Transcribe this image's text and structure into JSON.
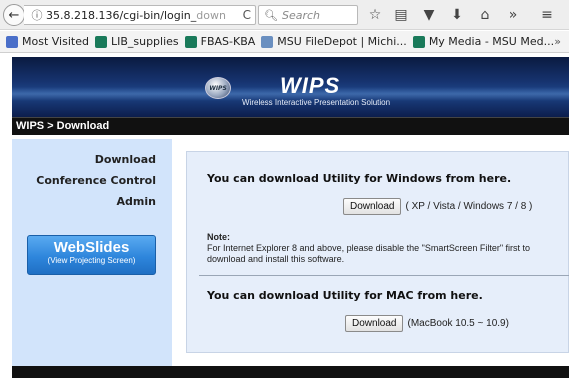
{
  "browser": {
    "url_main": "35.8.218.136/cgi-bin/login_",
    "url_dim": "down",
    "search_placeholder": "Search",
    "icons": [
      "back-icon",
      "info-icon",
      "reload-icon",
      "search-icon",
      "star-icon",
      "reader-icon",
      "pocket-icon",
      "download-icon",
      "home-icon",
      "overflow-icon",
      "menu-icon"
    ],
    "glyphs": {
      "back": "←",
      "info": "ⓘ",
      "reload": "C",
      "search": "🔍︎",
      "star": "☆",
      "reader": "▤",
      "pocket": "▼",
      "download": "⬇",
      "home": "⌂",
      "overflow": "»",
      "menu": "≡",
      "bookmarks_more": "»"
    }
  },
  "bookmarks": [
    {
      "label": "Most Visited",
      "icon_color": "#4a6fc9"
    },
    {
      "label": "LIB_supplies",
      "icon_color": "#1a7a5a"
    },
    {
      "label": "FBAS-KBA",
      "icon_color": "#1a7a5a"
    },
    {
      "label": "MSU FileDepot | Michi...",
      "icon_color": "#6a8fc0"
    },
    {
      "label": "My Media - MSU Med...",
      "icon_color": "#1a7a5a"
    }
  ],
  "banner": {
    "logo_badge": "WIPS",
    "title": "WIPS",
    "subtitle": "Wireless Interactive Presentation Solution"
  },
  "breadcrumb": "WIPS > Download",
  "sidebar": {
    "links": [
      "Download",
      "Conference Control",
      "Admin"
    ],
    "webslides_title": "WebSlides",
    "webslides_sub": "(View Projecting Screen)"
  },
  "content": {
    "windows_title": "You can download Utility for Windows from here.",
    "windows_button": "Download",
    "windows_compat": "( XP / Vista / Windows 7 / 8 )",
    "note_title": "Note:",
    "note_text": "For Internet Explorer 8 and above, please disable the \"SmartScreen Filter\" first to download and install this software.",
    "mac_title": "You can download Utility for MAC from here.",
    "mac_button": "Download",
    "mac_compat": "(MacBook 10.5 ~ 10.9)"
  },
  "colors": {
    "sidebar_bg": "#d2e4fb",
    "content_bg": "#e6eefa",
    "banner_dark": "#0a1a40",
    "webslides_blue": "#2e86dc"
  }
}
